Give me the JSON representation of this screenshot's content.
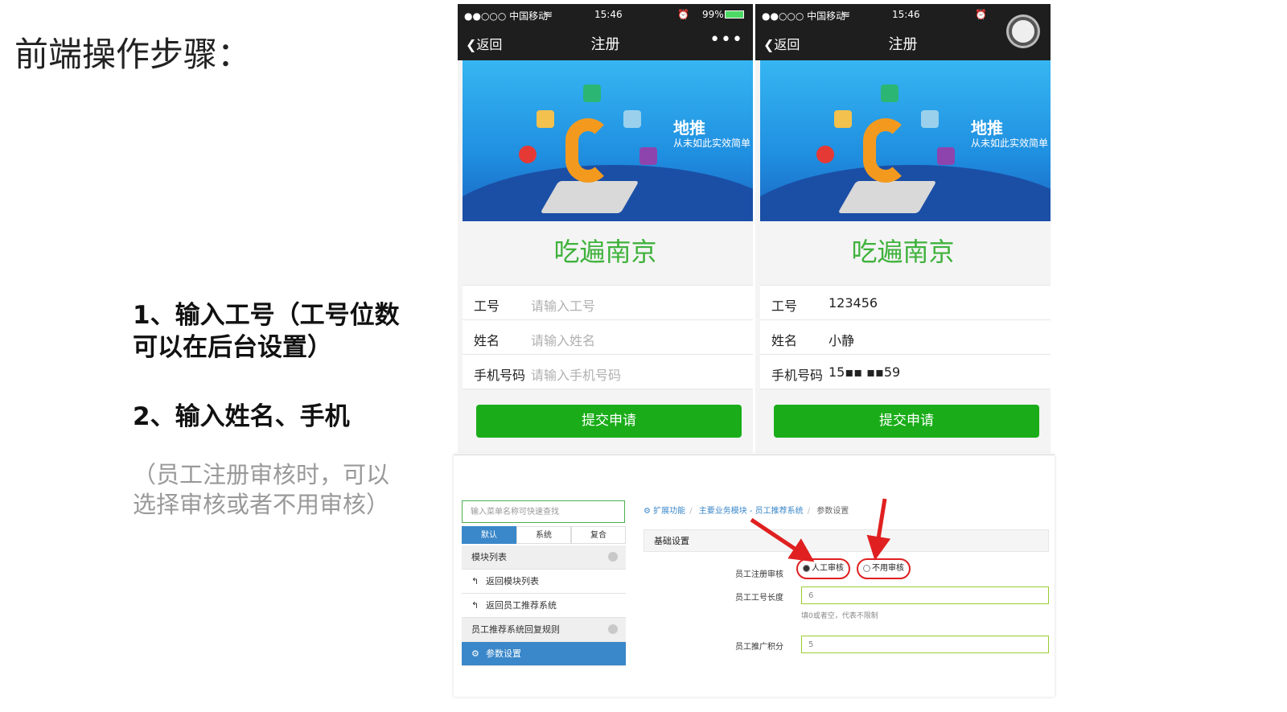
{
  "slide": {
    "title": "前端操作步骤：",
    "step1": "1、输入工号（工号位数可以在后台设置）",
    "step2": "2、输入姓名、手机",
    "note": "（员工注册审核时，可以选择审核或者不用审核）"
  },
  "phones": [
    {
      "status": {
        "carrier": "●●○○○ 中国移动",
        "time": "15:46",
        "battery": "99%"
      },
      "nav": {
        "back": "返回",
        "title": "注册",
        "more": "•••"
      },
      "banner": {
        "headline": "地推",
        "sub": "从未如此实效简单"
      },
      "brand": "吃遍南京",
      "fields": [
        {
          "label": "工号",
          "value": "请输入工号",
          "placeholder": true
        },
        {
          "label": "姓名",
          "value": "请输入姓名",
          "placeholder": true
        },
        {
          "label": "手机号码",
          "value": "请输入手机号码",
          "placeholder": true
        }
      ],
      "submit": "提交申请"
    },
    {
      "status": {
        "carrier": "●●○○○ 中国移动",
        "time": "15:46"
      },
      "nav": {
        "back": "返回",
        "title": "注册"
      },
      "banner": {
        "headline": "地推",
        "sub": "从未如此实效简单"
      },
      "brand": "吃遍南京",
      "fields": [
        {
          "label": "工号",
          "value": "123456",
          "placeholder": false
        },
        {
          "label": "姓名",
          "value": "小静",
          "placeholder": false
        },
        {
          "label": "手机号码",
          "value": "15▪▪  ▪▪59",
          "placeholder": false
        }
      ],
      "submit": "提交申请"
    }
  ],
  "admin": {
    "search_placeholder": "输入菜单名称可快速查找",
    "tabs": [
      "默认",
      "系统",
      "复合"
    ],
    "menu": [
      {
        "label": "模块列表",
        "type": "group"
      },
      {
        "label": "返回模块列表",
        "type": "link"
      },
      {
        "label": "返回员工推荐系统",
        "type": "link"
      },
      {
        "label": "员工推荐系统回复规则",
        "type": "group"
      },
      {
        "label": "参数设置",
        "type": "active"
      }
    ],
    "breadcrumb": [
      "扩展功能",
      "主要业务模块 - 员工推荐系统",
      "参数设置"
    ],
    "section": "基础设置",
    "fields": {
      "review_label": "员工注册审核",
      "review_options": [
        "人工审核",
        "不用审核"
      ],
      "review_selected": "人工审核",
      "length_label": "员工工号长度",
      "length_value": "6",
      "length_hint": "填0或者空，代表不限制",
      "points_label": "员工推广积分",
      "points_value": "5"
    }
  },
  "colors": {
    "wechat_green": "#1aad19",
    "brand_green": "#3fb23c",
    "admin_blue": "#3a87c9",
    "arrow_red": "#e02020"
  }
}
